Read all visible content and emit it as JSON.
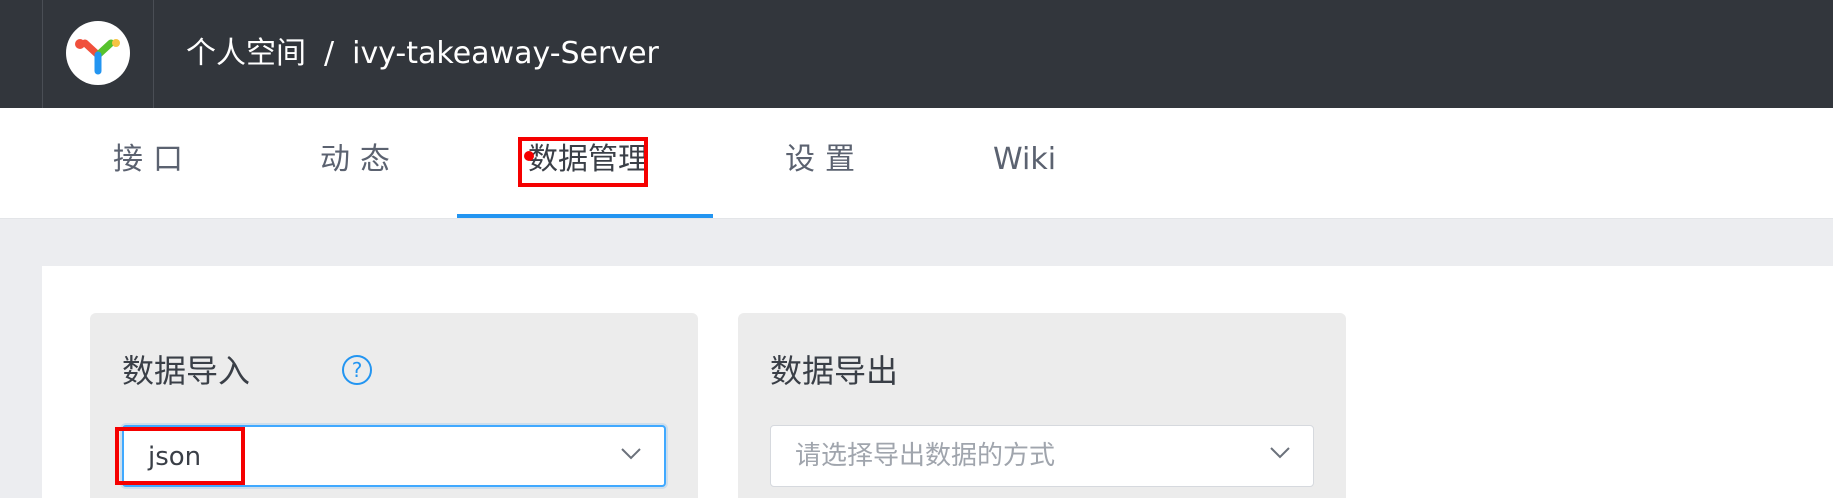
{
  "header": {
    "breadcrumb_space": "个人空间",
    "breadcrumb_separator": "/",
    "breadcrumb_project": "ivy-takeaway-Server",
    "logo_icon": "yapi-logo-icon"
  },
  "tabs": [
    {
      "label": "接口",
      "active": false
    },
    {
      "label": "动态",
      "active": false
    },
    {
      "label": "数据管理",
      "active": true
    },
    {
      "label": "设置",
      "active": false
    },
    {
      "label": "Wiki",
      "active": false
    }
  ],
  "import_card": {
    "title": "数据导入",
    "help_icon": "question-circle-icon",
    "help_symbol": "?",
    "select_value": "json"
  },
  "export_card": {
    "title": "数据导出",
    "select_placeholder": "请选择导出数据的方式"
  },
  "colors": {
    "topbar": "#32363c",
    "accent": "#2395f1",
    "highlight": "#f50000"
  }
}
